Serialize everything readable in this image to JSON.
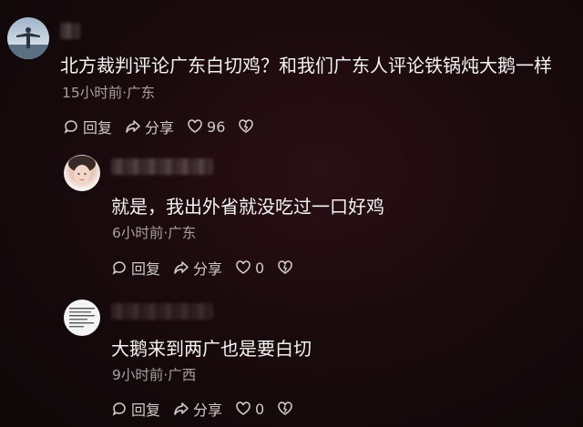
{
  "comments": [
    {
      "text": "北方裁判评论广东白切鸡？和我们广东人评论铁锅炖大鹅一样",
      "meta": "15小时前·广东",
      "reply_label": "回复",
      "share_label": "分享",
      "likes": "96"
    },
    {
      "text": "就是，我出外省就没吃过一口好鸡",
      "meta": "6小时前·广东",
      "reply_label": "回复",
      "share_label": "分享",
      "likes": "0"
    },
    {
      "text": "大鹅来到两广也是要白切",
      "meta": "9小时前·广西",
      "reply_label": "回复",
      "share_label": "分享",
      "likes": "0"
    }
  ],
  "icons": [
    "reply-icon",
    "share-icon",
    "like-heart-icon",
    "dislike-heart-icon"
  ],
  "colors": {
    "background": "#1a0a0e",
    "text": "#f4f4f4",
    "meta": "#a8a0a2"
  }
}
